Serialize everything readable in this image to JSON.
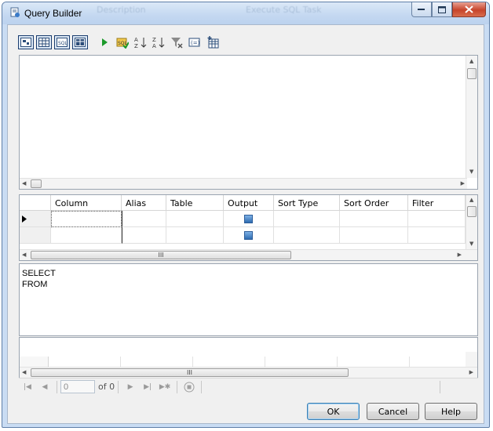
{
  "window": {
    "title": "Query Builder",
    "title_ghost_left": "Description",
    "title_ghost_right": "Execute SQL Task"
  },
  "toolbar": {
    "icons": [
      "diagram-pane-icon",
      "grid-pane-icon",
      "sql-pane-icon",
      "results-pane-icon",
      "run-icon",
      "verify-sql-icon",
      "sort-ascending-icon",
      "sort-descending-icon",
      "remove-filter-icon",
      "group-by-icon",
      "add-table-icon"
    ]
  },
  "grid": {
    "columns": [
      "Column",
      "Alias",
      "Table",
      "Output",
      "Sort Type",
      "Sort Order",
      "Filter"
    ],
    "rows": [
      {
        "current": true,
        "column": "",
        "alias": "",
        "table": "",
        "output": true,
        "sort_type": "",
        "sort_order": "",
        "filter": ""
      },
      {
        "current": false,
        "column": "",
        "alias": "",
        "table": "",
        "output": true,
        "sort_type": "",
        "sort_order": "",
        "filter": ""
      }
    ],
    "scroll_thumb_label": "III"
  },
  "sql": {
    "line1": "SELECT",
    "line2": "FROM"
  },
  "results": {
    "scroll_thumb_label": "III"
  },
  "navigator": {
    "page_value": "0",
    "of_label": "of 0"
  },
  "buttons": {
    "ok": "OK",
    "cancel": "Cancel",
    "help": "Help"
  },
  "colors": {
    "title_bar": "#c4d8f1",
    "close_button": "#c7442a",
    "checkbox": "#2e6bb0"
  }
}
